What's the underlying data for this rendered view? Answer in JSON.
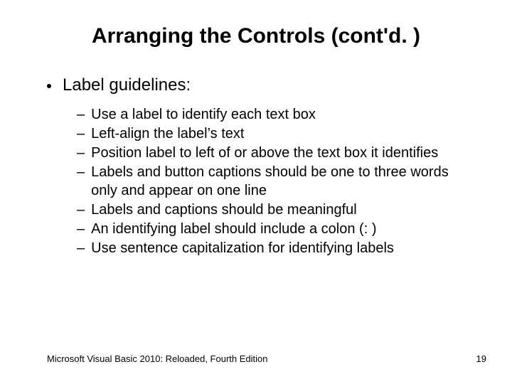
{
  "title": "Arranging the Controls (cont'd. )",
  "main_bullet": "Label guidelines:",
  "sub_bullets": [
    "Use a label to identify each text box",
    "Left-align the label’s text",
    "Position label to left of or above the text box it identifies",
    "Labels and button captions should be one to three words only and appear on one line",
    "Labels and captions should be meaningful",
    "An identifying label should include a colon (: )",
    "Use sentence capitalization for identifying labels"
  ],
  "footer_left": "Microsoft Visual Basic 2010: Reloaded, Fourth Edition",
  "footer_right": "19"
}
